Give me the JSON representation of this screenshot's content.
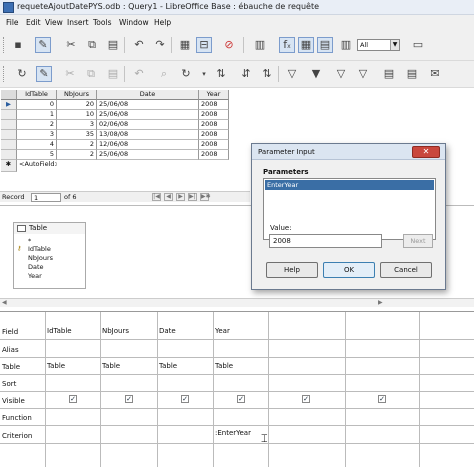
{
  "window": {
    "title": "requeteAjoutDatePYS.odb : Query1 - LibreOffice Base : ébauche de requête"
  },
  "menu": [
    "File",
    "Edit",
    "View",
    "Insert",
    "Tools",
    "Window",
    "Help"
  ],
  "toolbar": {
    "filter_select": "All",
    "function_label": "f"
  },
  "data_grid": {
    "columns": [
      "IdTable",
      "NbJours",
      "Date",
      "Year"
    ],
    "rows": [
      {
        "marker": "▶",
        "IdTable": "0",
        "NbJours": "20",
        "Date": "25/06/08",
        "Year": "2008"
      },
      {
        "marker": "",
        "IdTable": "1",
        "NbJours": "10",
        "Date": "25/06/08",
        "Year": "2008"
      },
      {
        "marker": "",
        "IdTable": "2",
        "NbJours": "3",
        "Date": "02/06/08",
        "Year": "2008"
      },
      {
        "marker": "",
        "IdTable": "3",
        "NbJours": "35",
        "Date": "13/08/08",
        "Year": "2008"
      },
      {
        "marker": "",
        "IdTable": "4",
        "NbJours": "2",
        "Date": "12/06/08",
        "Year": "2008"
      },
      {
        "marker": "",
        "IdTable": "5",
        "NbJours": "2",
        "Date": "25/06/08",
        "Year": "2008"
      }
    ],
    "new_row": {
      "marker": "✱",
      "IdTable": "<AutoField>"
    }
  },
  "record_nav": {
    "label": "Record",
    "current": "1",
    "of_label": "of 6"
  },
  "table_window": {
    "title": "Table",
    "fields": [
      "*",
      "IdTable",
      "NbJours",
      "Date",
      "Year"
    ]
  },
  "query_grid": {
    "row_labels": [
      "Field",
      "Alias",
      "Table",
      "Sort",
      "Visible",
      "Function",
      "Criterion"
    ],
    "columns": [
      {
        "field": "IdTable",
        "table": "Table",
        "visible": true,
        "criterion": ""
      },
      {
        "field": "NbJours",
        "table": "Table",
        "visible": true,
        "criterion": ""
      },
      {
        "field": "Date",
        "table": "Table",
        "visible": true,
        "criterion": ""
      },
      {
        "field": "Year",
        "table": "Table",
        "visible": true,
        "criterion": ":EnterYear"
      },
      {
        "field": "",
        "table": "",
        "visible": true,
        "criterion": ""
      },
      {
        "field": "",
        "table": "",
        "visible": true,
        "criterion": ""
      }
    ]
  },
  "dialog": {
    "title": "Parameter Input",
    "parameters_label": "Parameters",
    "parameters": [
      "EnterYear"
    ],
    "value_label": "Value:",
    "value": "2008",
    "next_label": "Next",
    "help_label": "Help",
    "ok_label": "OK",
    "cancel_label": "Cancel",
    "close_glyph": "✕"
  }
}
